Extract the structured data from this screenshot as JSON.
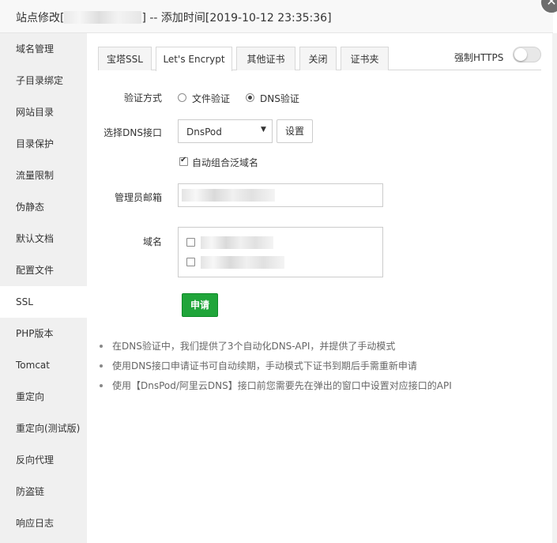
{
  "window": {
    "title_prefix": "站点修改[",
    "title_suffix": "] -- 添加时间[2019-10-12 23:35:36]",
    "close_icon": "close-icon"
  },
  "sidebar": {
    "items": [
      {
        "label": "域名管理"
      },
      {
        "label": "子目录绑定"
      },
      {
        "label": "网站目录"
      },
      {
        "label": "目录保护"
      },
      {
        "label": "流量限制"
      },
      {
        "label": "伪静态"
      },
      {
        "label": "默认文档"
      },
      {
        "label": "配置文件"
      },
      {
        "label": "SSL",
        "active": true
      },
      {
        "label": "PHP版本"
      },
      {
        "label": "Tomcat"
      },
      {
        "label": "重定向"
      },
      {
        "label": "重定向(测试版)"
      },
      {
        "label": "反向代理"
      },
      {
        "label": "防盗链"
      },
      {
        "label": "响应日志"
      }
    ]
  },
  "tabs": [
    {
      "label": "宝塔SSL"
    },
    {
      "label": "Let's Encrypt",
      "active": true
    },
    {
      "label": "其他证书"
    },
    {
      "label": "关闭"
    },
    {
      "label": "证书夹"
    }
  ],
  "force_https": {
    "label": "强制HTTPS",
    "enabled": false
  },
  "form": {
    "verify_label": "验证方式",
    "verify_options": [
      {
        "label": "文件验证",
        "checked": false
      },
      {
        "label": "DNS验证",
        "checked": true
      }
    ],
    "dns_label": "选择DNS接口",
    "dns_selected": "DnsPod",
    "dns_settings_button": "设置",
    "wildcard_label": "自动组合泛域名",
    "wildcard_checked": true,
    "email_label": "管理员邮箱",
    "domain_label": "域名",
    "domain_checkboxes": [
      {
        "checked": false
      },
      {
        "checked": false
      }
    ],
    "apply_button": "申请"
  },
  "tips": [
    "在DNS验证中，我们提供了3个自动化DNS-API，并提供了手动模式",
    "使用DNS接口申请证书可自动续期，手动模式下证书到期后手需重新申请",
    "使用【DnsPod/阿里云DNS】接口前您需要先在弹出的窗口中设置对应接口的API"
  ],
  "colors": {
    "primary_green": "#20a53a",
    "sidebar_bg": "#f0f0f0",
    "titlebar_bg": "#f8f8f8"
  }
}
